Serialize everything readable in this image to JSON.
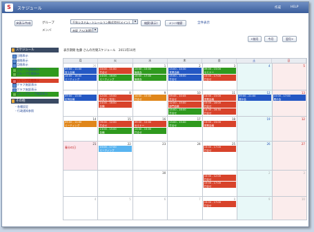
{
  "app": {
    "title": "スケジュール",
    "link_config": "作成",
    "link_help": "HELP"
  },
  "toolbar": {
    "menu_label": "戻表示/作成",
    "group_label": "グループ",
    "group_value": "千年システム・トレーション株式会社(メイン)",
    "member_label": "メンバ",
    "member_value": "赤坂 さん(本館)",
    "btn_group_search": "検索(表示)",
    "btn_member_search": "メンバ検索",
    "link_all": "全件表示",
    "btn_prev": "<前月",
    "btn_today": "今月",
    "btn_next": "翌月>"
  },
  "sidebar": {
    "schedule_head": "スケジュール",
    "items": [
      {
        "label": "日間表示",
        "style": ""
      },
      {
        "label": "週間表示",
        "style": ""
      },
      {
        "label": "月間表示",
        "style": ""
      },
      {
        "label": "グループ週間表示",
        "style": "green"
      },
      {
        "label": "グループ月間表示",
        "style": "green"
      }
    ],
    "items2": [
      {
        "label": "グループ月間表示",
        "style": "red"
      },
      {
        "label": "グラフ施設表示",
        "style": ""
      },
      {
        "label": "グラフ施設表示",
        "style": ""
      },
      {
        "label": "ディングループ施設表示",
        "style": "green"
      }
    ],
    "misc_head": "その他",
    "links": [
      "・各種設定",
      "・行政通知参照"
    ]
  },
  "info": {
    "text": "表示期間 佐藤 さんの月間スケジュール　2011年10月"
  },
  "calendar": {
    "weekdays": [
      "月",
      "火",
      "水",
      "木",
      "金",
      "土",
      "日"
    ],
    "weeks": [
      {
        "days": [
          {
            "num": "26",
            "other": true,
            "events": [
              {
                "text": [
                  "09:00 - 11:00",
                  "富士会議"
                ],
                "color": "blue",
                "slot": 0
              },
              {
                "text": [
                  "14:00 - 16:00",
                  "ミーティング"
                ],
                "color": "blue",
                "slot": 1
              }
            ]
          },
          {
            "num": "",
            "events": [
              {
                "text": [
                  "10:00 - 11:00",
                  "打合せ"
                ],
                "color": "red",
                "slot": 0
              },
              {
                "text": [
                  "14:00 - 16:00",
                  "ミーティング"
                ],
                "color": "green",
                "slot": 1
              }
            ]
          },
          {
            "num": "1",
            "events": [
              {
                "text": [
                  "13:00 - 15:00",
                  "勉強会"
                ],
                "color": "green",
                "slot": 0
              },
              {
                "text": [
                  "15:00 - 17:00",
                  "勉強会"
                ],
                "color": "green",
                "slot": 1
              }
            ]
          },
          {
            "num": "2",
            "events": [
              {
                "text": [
                  "13:00 - 14:30",
                  "営業会議"
                ],
                "color": "blue",
                "slot": 0
              },
              {
                "text": [
                  "15:00 - 16:00",
                  "打合せ"
                ],
                "color": "blue",
                "slot": 1
              }
            ]
          },
          {
            "num": "3",
            "events": [
              {
                "text": [
                  "09:00 - 15:00",
                  "セミナー"
                ],
                "color": "green",
                "slot": 0
              },
              {
                "text": [
                  "15:00 - 17:00",
                  "打合せ"
                ],
                "color": "red",
                "slot": 1
              }
            ]
          },
          {
            "num": "4",
            "sat": true,
            "events": []
          },
          {
            "num": "5",
            "sun": true,
            "events": []
          }
        ]
      },
      {
        "days": [
          {
            "num": "",
            "events": [
              {
                "text": [
                  "09:00 - 13:00",
                  "定例会議"
                ],
                "color": "blue",
                "slot": 0
              }
            ]
          },
          {
            "num": "8",
            "events": [
              {
                "text": [
                  "12:00 - 15:00",
                  "打合せ（支社）"
                ],
                "color": "red",
                "slot": 0
              },
              {
                "text": [
                  "14:00 - 16:00",
                  "会議"
                ],
                "color": "red",
                "slot": 1
              }
            ]
          },
          {
            "num": "9",
            "events": [
              {
                "text": [
                  "14:00 - 15:00",
                  "打合せ"
                ],
                "color": "orange",
                "slot": 0
              }
            ]
          },
          {
            "num": "10",
            "events": [
              {
                "text": [
                  "09:45 - 10:45",
                  "打合せ"
                ],
                "color": "red",
                "slot": 0
              },
              {
                "text": [
                  "12:00 - 15:00",
                  "部門会議"
                ],
                "color": "red",
                "slot": 1
              },
              {
                "text": [
                  "15:00 - 16:00",
                  "打合せ"
                ],
                "color": "green",
                "slot": 2
              }
            ]
          },
          {
            "num": "11",
            "events": [
              {
                "text": [
                  "14:00 - 15:00",
                  "営業会議"
                ],
                "color": "red",
                "slot": 0
              },
              {
                "text": [
                  "15:00 - 16:00",
                  "打合せ"
                ],
                "color": "red",
                "slot": 1
              },
              {
                "text": [
                  "14:30 - 16:30",
                  "打合せ"
                ],
                "color": "red",
                "slot": 2
              }
            ]
          },
          {
            "num": "12",
            "sat": true,
            "events": [
              {
                "text": [
                  "09:00 - 21:00",
                  "展示会"
                ],
                "color": "blue",
                "slot": 0
              }
            ]
          },
          {
            "num": "13",
            "sun": true,
            "events": [
              {
                "text": [
                  "10:00 - 17:00",
                  "展示会"
                ],
                "color": "blue",
                "slot": 0
              }
            ]
          }
        ]
      },
      {
        "days": [
          {
            "num": "14",
            "events": [
              {
                "text": [
                  "09:00 - 11:00",
                  "ミーティング"
                ],
                "color": "orange",
                "slot": 0
              }
            ]
          },
          {
            "num": "15",
            "events": [
              {
                "text": [
                  "09:00 - 12:00",
                  "打合せ"
                ],
                "color": "red",
                "slot": 0
              },
              {
                "text": [
                  "13:00 - 15:00",
                  "会議"
                ],
                "color": "green",
                "slot": 1
              }
            ]
          },
          {
            "num": "16",
            "events": [
              {
                "text": [
                  "09:00 - 12:00",
                  "セミナー"
                ],
                "color": "red",
                "slot": 0
              },
              {
                "text": [
                  "13:00 - 15:00",
                  "打合せ"
                ],
                "color": "green",
                "slot": 1
              }
            ]
          },
          {
            "num": "17",
            "events": [
              {
                "text": [
                  "13:00 - 15:00",
                  "打合せ"
                ],
                "color": "green",
                "slot": 0
              }
            ]
          },
          {
            "num": "18",
            "events": [
              {
                "text": [
                  "13:00 - 15:00",
                  "営業会議"
                ],
                "color": "red",
                "slot": 0
              }
            ]
          },
          {
            "num": "19",
            "sat": true,
            "events": []
          },
          {
            "num": "12",
            "sun": true,
            "events": []
          }
        ]
      },
      {
        "days": [
          {
            "num": "21",
            "holiday": true,
            "holiday_text": "春分の日",
            "events": []
          },
          {
            "num": "22",
            "events": [
              {
                "text": [
                  "15:00 - 17:00",
                  "ミーティング"
                ],
                "color": "lblue",
                "slot": 0
              }
            ]
          },
          {
            "num": "23",
            "events": []
          },
          {
            "num": "24",
            "events": []
          },
          {
            "num": "25",
            "events": [
              {
                "text": [
                  "15:00 - 17:00",
                  "打合せ"
                ],
                "color": "red",
                "slot": 0
              }
            ]
          },
          {
            "num": "26",
            "sat": true,
            "events": []
          },
          {
            "num": "27",
            "sun": true,
            "events": []
          }
        ]
      },
      {
        "days": [
          {
            "num": "",
            "events": []
          },
          {
            "num": "",
            "events": []
          },
          {
            "num": "30",
            "events": []
          },
          {
            "num": "",
            "events": []
          },
          {
            "num": "",
            "events": [
              {
                "text": [
                  "10:00 - 12:00",
                  "打合せ"
                ],
                "color": "red",
                "slot": 0
              },
              {
                "text": [
                  "15:00 - 17:00",
                  "打合せ"
                ],
                "color": "red",
                "slot": 1
              }
            ]
          },
          {
            "num": "2",
            "sat": true,
            "other": true,
            "events": []
          },
          {
            "num": "3",
            "sun": true,
            "other": true,
            "events": []
          }
        ]
      },
      {
        "days": [
          {
            "num": "4",
            "other": true,
            "events": []
          },
          {
            "num": "5",
            "other": true,
            "events": []
          },
          {
            "num": "6",
            "other": true,
            "events": []
          },
          {
            "num": "7",
            "other": true,
            "events": []
          },
          {
            "num": "8",
            "other": true,
            "events": [
              {
                "text": [
                  "15:00 - 17:00",
                  "打合せ"
                ],
                "color": "red",
                "slot": 0
              }
            ]
          },
          {
            "num": "9",
            "sat": true,
            "other": true,
            "events": []
          },
          {
            "num": "10",
            "sun": true,
            "other": true,
            "events": []
          }
        ]
      }
    ]
  }
}
